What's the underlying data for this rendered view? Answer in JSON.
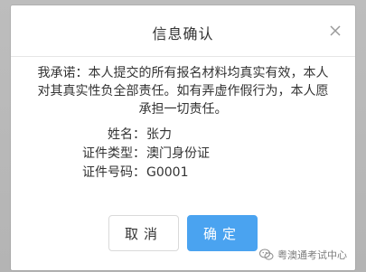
{
  "dialog": {
    "title": "信息确认",
    "statement_line1": "我承诺：本人提交的所有报名材料均真实有效，本人",
    "statement_line2": "对其真实性负全部责任。如有弄虚作假行为，本人愿",
    "statement_line3": "承担一切责任。",
    "fields": [
      {
        "label": "姓名：",
        "value": "张力"
      },
      {
        "label": "证件类型：",
        "value": "澳门身份证"
      },
      {
        "label": "证件号码：",
        "value": "G0001"
      }
    ],
    "cancel_label": "取消",
    "confirm_label": "确定",
    "close_icon": "close-icon"
  },
  "watermark": {
    "text": "粤澳通考试中心",
    "icon": "wechat-icon"
  },
  "colors": {
    "confirm_button": "#4aa3f0",
    "backdrop": "#b9b9b9",
    "text": "#333333"
  }
}
